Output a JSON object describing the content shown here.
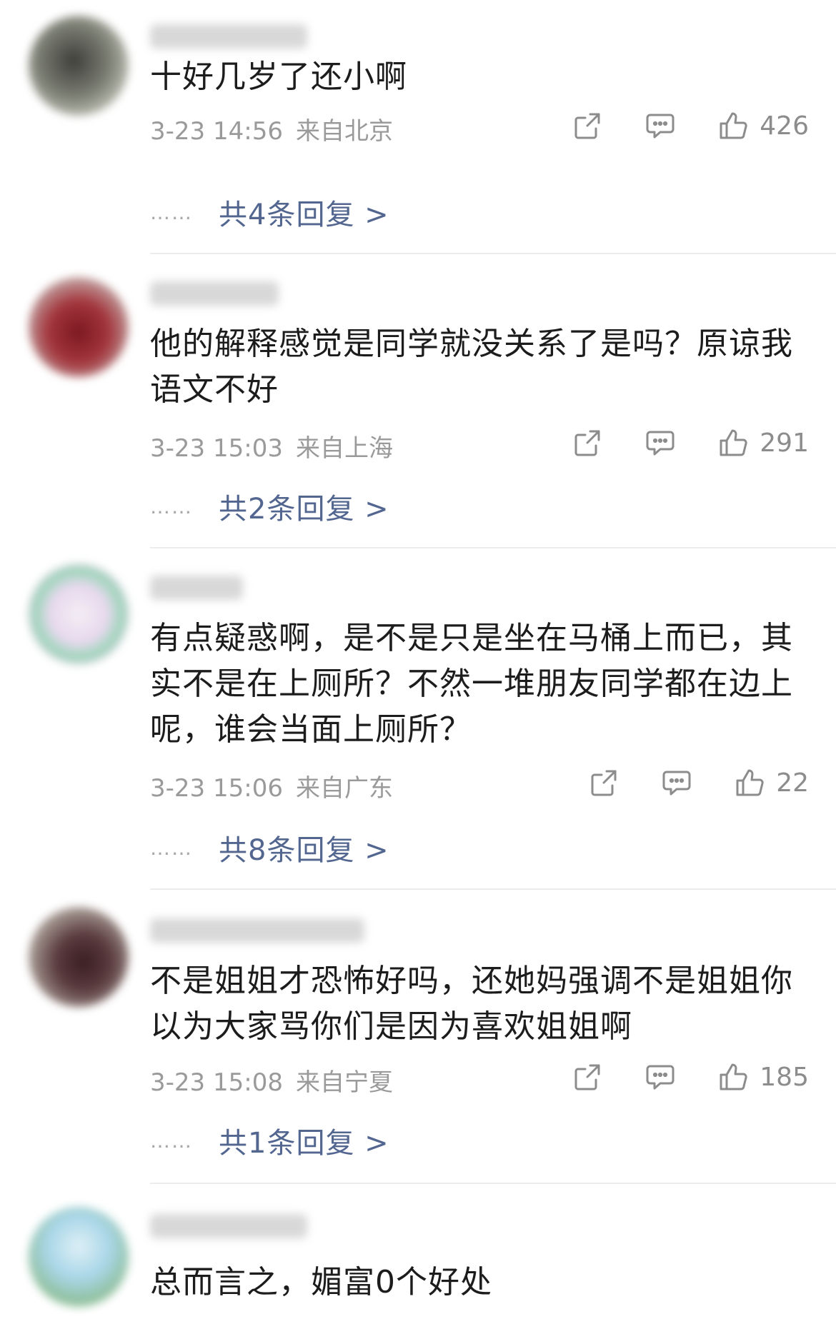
{
  "comments": [
    {
      "content": "十好几岁了还小啊",
      "date": "3-23 14:56",
      "location": "来自北京",
      "likes": "426",
      "reply_prefix": "……",
      "reply_text": "共4条回复 >",
      "avatar_color": "#6b6f63"
    },
    {
      "content": "他的解释感觉是同学就没关系了是吗？原谅我语文不好",
      "date": "3-23 15:03",
      "location": "来自上海",
      "likes": "291",
      "reply_prefix": "……",
      "reply_text": "共2条回复 >",
      "avatar_color": "#9a2c34"
    },
    {
      "content": "有点疑惑啊，是不是只是坐在马桶上而已，其实不是在上厕所？不然一堆朋友同学都在边上呢，谁会当面上厕所？",
      "date": "3-23 15:06",
      "location": "来自广东",
      "likes": "22",
      "reply_prefix": "……",
      "reply_text": "共8条回复 >",
      "avatar_color": "#c9a9d4"
    },
    {
      "content": "不是姐姐才恐怖好吗，还她妈强调不是姐姐你以为大家骂你们是因为喜欢姐姐啊",
      "date": "3-23 15:08",
      "location": "来自宁夏",
      "likes": "185",
      "reply_prefix": "……",
      "reply_text": "共1条回复 >",
      "avatar_color": "#5a3b3e"
    },
    {
      "content": "总而言之，媚富0个好处",
      "avatar_color": "#8fbf9a"
    }
  ],
  "colors": {
    "reply_link": "#52668f",
    "meta_text": "#9a9a9a",
    "divider": "#ececec"
  },
  "icons": [
    "share-icon",
    "comment-icon",
    "thumbs-up-icon"
  ]
}
